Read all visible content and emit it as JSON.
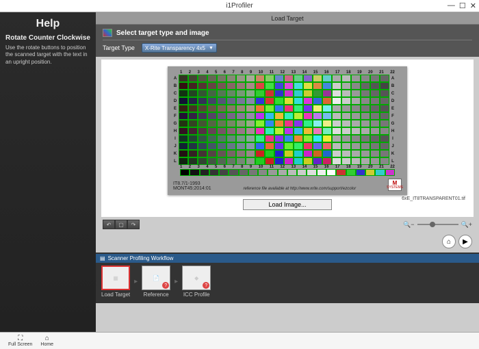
{
  "window": {
    "title": "i1Profiler",
    "min": "—",
    "max": "☐",
    "close": "✕"
  },
  "help": {
    "heading": "Help",
    "subheading": "Rotate Counter Clockwise",
    "body": "Use the rotate buttons to position the scanned target with the text in an upright position."
  },
  "tabbar": {
    "active": "Load Target"
  },
  "panel": {
    "title": "Select target type and image",
    "targetTypeLabel": "Target Type",
    "targetTypeValue": "X-Rite Transparency 4x5"
  },
  "target": {
    "cols": [
      "1",
      "2",
      "3",
      "4",
      "5",
      "6",
      "7",
      "8",
      "9",
      "10",
      "11",
      "12",
      "13",
      "14",
      "15",
      "16",
      "17",
      "18",
      "19",
      "20",
      "21",
      "22"
    ],
    "rows": [
      "A",
      "B",
      "C",
      "D",
      "E",
      "F",
      "G",
      "H",
      "I",
      "J",
      "K",
      "L"
    ],
    "standard": "IT8.7/1-1993",
    "batch": "MONT45:2014:01",
    "refnote": "reference file available at http://www.xrite.com/support/ezcolor",
    "logo1": "M",
    "logo2": "SYSTEMS",
    "filename": "6xE_IT8TRANSPARENT01.tif"
  },
  "buttons": {
    "loadImage": "Load Image..."
  },
  "rot": {
    "ccw": "↶",
    "none": "▢",
    "cw": "↷"
  },
  "zoom": {
    "out": "🔍−",
    "in": "🔍+"
  },
  "nav": {
    "home": "⌂",
    "play": "▶",
    "homeLbl": "Home",
    "playLbl": "Next"
  },
  "workflow": {
    "title": "Scanner Profiling Workflow",
    "items": [
      {
        "label": "Load Target",
        "selected": true,
        "glyph": "▦"
      },
      {
        "label": "Reference",
        "selected": false,
        "glyph": "📄"
      },
      {
        "label": "ICC Profile",
        "selected": false,
        "glyph": "◆"
      }
    ]
  },
  "bottombar": {
    "fullscreen": {
      "icon": "⛶",
      "label": "Full Screen"
    },
    "home": {
      "icon": "⌂",
      "label": "Home"
    }
  },
  "palette": {
    "rowColors": [
      [
        "#332",
        "#443",
        "#554",
        "#665",
        "#776",
        "#887",
        "#998",
        "#aa9",
        "#c86",
        "#8c6",
        "#68c",
        "#c68",
        "#6c8",
        "#86c",
        "#cc6",
        "#6cc",
        "#aaa",
        "#bbb",
        "#999",
        "#888",
        "#777",
        "#666"
      ],
      [
        "#311",
        "#422",
        "#533",
        "#644",
        "#755",
        "#866",
        "#977",
        "#a88",
        "#d44",
        "#4d4",
        "#44d",
        "#d4d",
        "#4dd",
        "#dd4",
        "#d84",
        "#48d",
        "#ccc",
        "#aaa",
        "#888",
        "#666",
        "#555",
        "#444"
      ],
      [
        "#131",
        "#242",
        "#353",
        "#464",
        "#575",
        "#686",
        "#797",
        "#8a8",
        "#3c3",
        "#c33",
        "#33c",
        "#c3c",
        "#3cc",
        "#cc3",
        "#393",
        "#939",
        "#ddd",
        "#bbb",
        "#999",
        "#777",
        "#666",
        "#555"
      ],
      [
        "#113",
        "#224",
        "#335",
        "#446",
        "#557",
        "#668",
        "#779",
        "#88a",
        "#33d",
        "#d33",
        "#3d3",
        "#dd3",
        "#3dd",
        "#d3d",
        "#36d",
        "#d63",
        "#eee",
        "#ccc",
        "#aaa",
        "#888",
        "#777",
        "#666"
      ],
      [
        "#321",
        "#432",
        "#543",
        "#654",
        "#765",
        "#876",
        "#987",
        "#a98",
        "#e73",
        "#7e3",
        "#37e",
        "#e37",
        "#3e7",
        "#73e",
        "#ee7",
        "#7ee",
        "#aaa",
        "#999",
        "#888",
        "#777",
        "#666",
        "#555"
      ],
      [
        "#213",
        "#324",
        "#435",
        "#546",
        "#657",
        "#768",
        "#879",
        "#98a",
        "#b3e",
        "#3be",
        "#eb3",
        "#3eb",
        "#be3",
        "#e3b",
        "#b7e",
        "#7be",
        "#bbb",
        "#aaa",
        "#999",
        "#888",
        "#777",
        "#666"
      ],
      [
        "#231",
        "#342",
        "#453",
        "#564",
        "#675",
        "#786",
        "#897",
        "#9a8",
        "#8e3",
        "#38e",
        "#e83",
        "#e38",
        "#83e",
        "#3e8",
        "#8ee",
        "#ee8",
        "#ccc",
        "#bbb",
        "#aaa",
        "#999",
        "#888",
        "#777"
      ],
      [
        "#312",
        "#423",
        "#534",
        "#645",
        "#756",
        "#867",
        "#978",
        "#a89",
        "#e3b",
        "#3eb",
        "#be3",
        "#b3e",
        "#3be",
        "#eb3",
        "#e7b",
        "#7eb",
        "#ddd",
        "#ccc",
        "#bbb",
        "#aaa",
        "#999",
        "#888"
      ],
      [
        "#132",
        "#243",
        "#354",
        "#465",
        "#576",
        "#687",
        "#798",
        "#8a9",
        "#3e8",
        "#e38",
        "#83e",
        "#38e",
        "#e83",
        "#8e3",
        "#3ee",
        "#ee3",
        "#aaa",
        "#999",
        "#888",
        "#777",
        "#666",
        "#555"
      ],
      [
        "#123",
        "#234",
        "#345",
        "#456",
        "#567",
        "#678",
        "#789",
        "#89a",
        "#36e",
        "#e63",
        "#63e",
        "#6e3",
        "#3e6",
        "#e36",
        "#66e",
        "#e66",
        "#bbb",
        "#aaa",
        "#999",
        "#888",
        "#777",
        "#666"
      ],
      [
        "#211",
        "#322",
        "#433",
        "#544",
        "#655",
        "#766",
        "#877",
        "#988",
        "#c22",
        "#2c2",
        "#22c",
        "#cc2",
        "#2cc",
        "#c2c",
        "#c62",
        "#26c",
        "#ccc",
        "#bbb",
        "#aaa",
        "#999",
        "#888",
        "#777"
      ],
      [
        "#121",
        "#232",
        "#343",
        "#454",
        "#565",
        "#676",
        "#787",
        "#898",
        "#2c2",
        "#c22",
        "#22c",
        "#c2c",
        "#2cc",
        "#cc2",
        "#62c",
        "#c26",
        "#ddd",
        "#ccc",
        "#bbb",
        "#aaa",
        "#999",
        "#888"
      ]
    ],
    "bottomStrip": [
      "#000",
      "#111",
      "#222",
      "#333",
      "#444",
      "#555",
      "#666",
      "#777",
      "#888",
      "#999",
      "#aaa",
      "#bbb",
      "#ccc",
      "#ddd",
      "#eee",
      "#fff",
      "#c33",
      "#3c3",
      "#33c",
      "#cc3",
      "#3cc",
      "#c3c"
    ]
  }
}
